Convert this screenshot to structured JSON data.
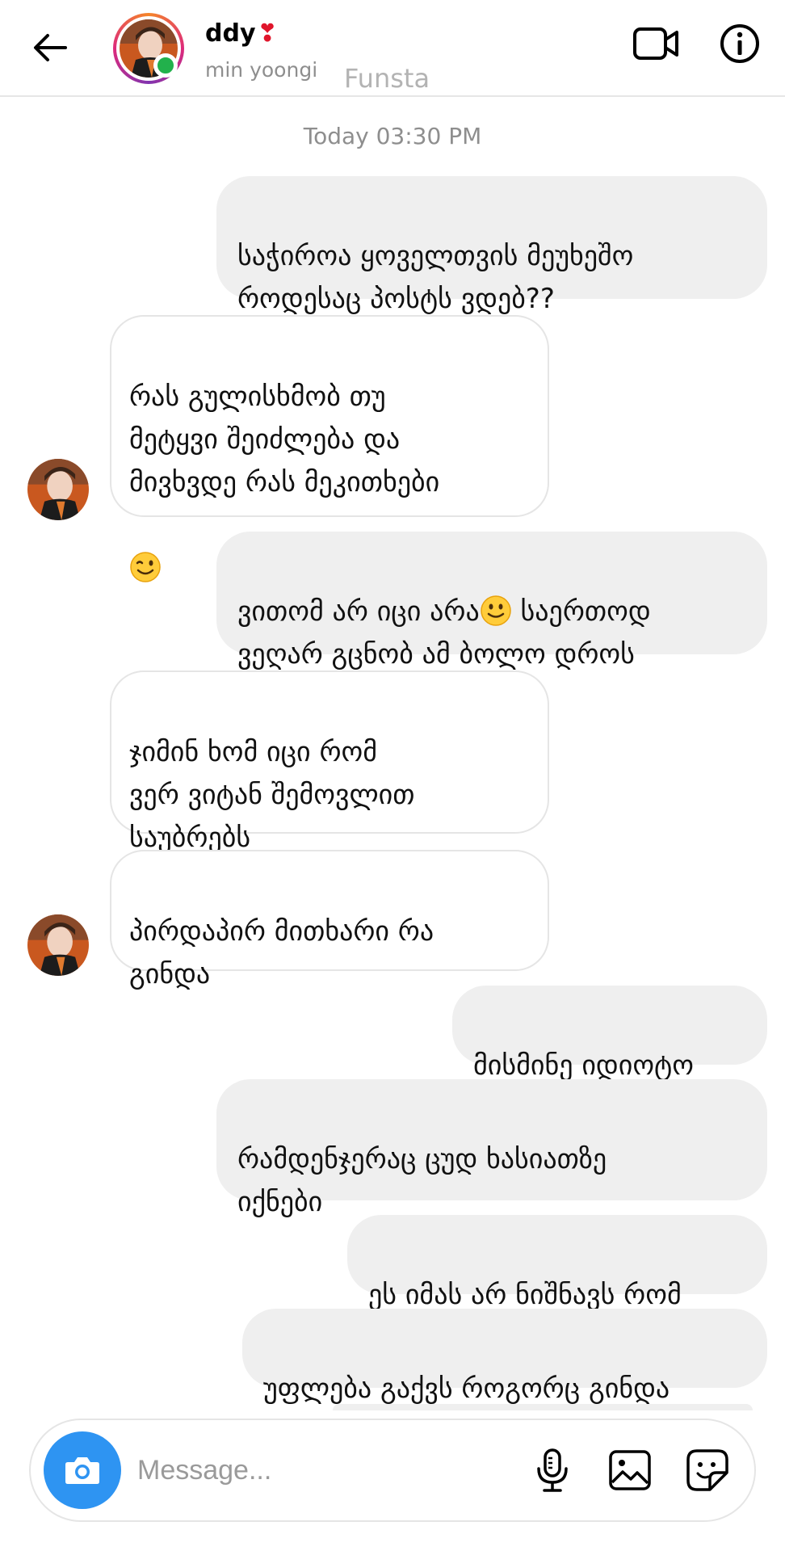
{
  "header": {
    "name": "ddy",
    "heart": "❣",
    "username": "min yoongi",
    "overlay_text": "Funsta",
    "back_icon": "arrow-left-icon",
    "video_icon": "video-call-icon",
    "info_icon": "info-icon"
  },
  "timestamp": "Today 03:30 PM",
  "messages": [
    {
      "side": "out",
      "text": "საჭიროა ყოველთვის მეუხეშო\nროდესაც პოსტს ვდებ??"
    },
    {
      "side": "in",
      "text": "რას გულისხმობ თუ\nმეტყვი შეიძლება და\nმივხვდე რას მეკითხები",
      "emoji": "winking-face"
    },
    {
      "side": "out",
      "text_a": "ვითომ არ იცი არა",
      "emoji": "slightly-smiling-face",
      "text_b": " საერთოდ\nვეღარ გცნობ ამ ბოლო დროს"
    },
    {
      "side": "in",
      "text": "ჯიმინ ხომ იცი რომ\nვერ ვიტან შემოვლით\nსაუბრებს"
    },
    {
      "side": "in",
      "text": "პირდაპირ მითხარი რა\nგინდა"
    },
    {
      "side": "out",
      "text": "მისმინე იდიოტო"
    },
    {
      "side": "out",
      "text": "რამდენჯერაც ცუდ ხასიათზე\nიქნები"
    },
    {
      "side": "out",
      "text": "ეს იმას არ ნიშნავს რომ"
    },
    {
      "side": "out",
      "text": "უფლება გაქვს როგორც გინდა"
    }
  ],
  "composer": {
    "placeholder": "Message...",
    "camera_icon": "camera-icon",
    "mic_icon": "microphone-icon",
    "gallery_icon": "gallery-icon",
    "sticker_icon": "sticker-icon"
  },
  "colors": {
    "outgoing_bubble": "#efefef",
    "camera_button": "#2e94f2",
    "online_dot": "#22b14c",
    "heart": "#e0152b"
  }
}
